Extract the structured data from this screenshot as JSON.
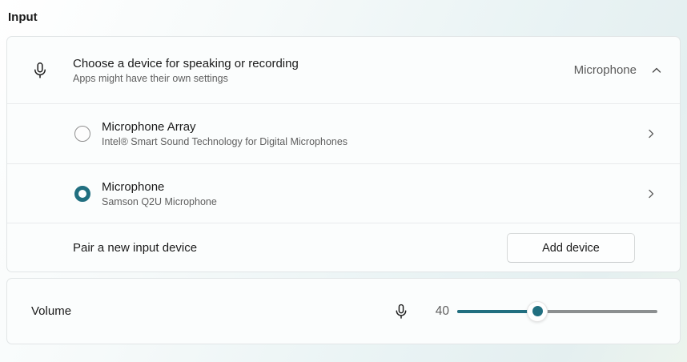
{
  "accent_color": "#216f80",
  "section": {
    "title": "Input"
  },
  "chooser": {
    "title": "Choose a device for speaking or recording",
    "subtitle": "Apps might have their own settings",
    "selected_value": "Microphone"
  },
  "devices": [
    {
      "name": "Microphone Array",
      "description": "Intel® Smart Sound Technology for Digital Microphones",
      "selected": false
    },
    {
      "name": "Microphone",
      "description": "Samson Q2U Microphone",
      "selected": true
    }
  ],
  "pair": {
    "label": "Pair a new input device",
    "button_label": "Add device"
  },
  "volume": {
    "label": "Volume",
    "value": 40,
    "min": 0,
    "max": 100
  }
}
